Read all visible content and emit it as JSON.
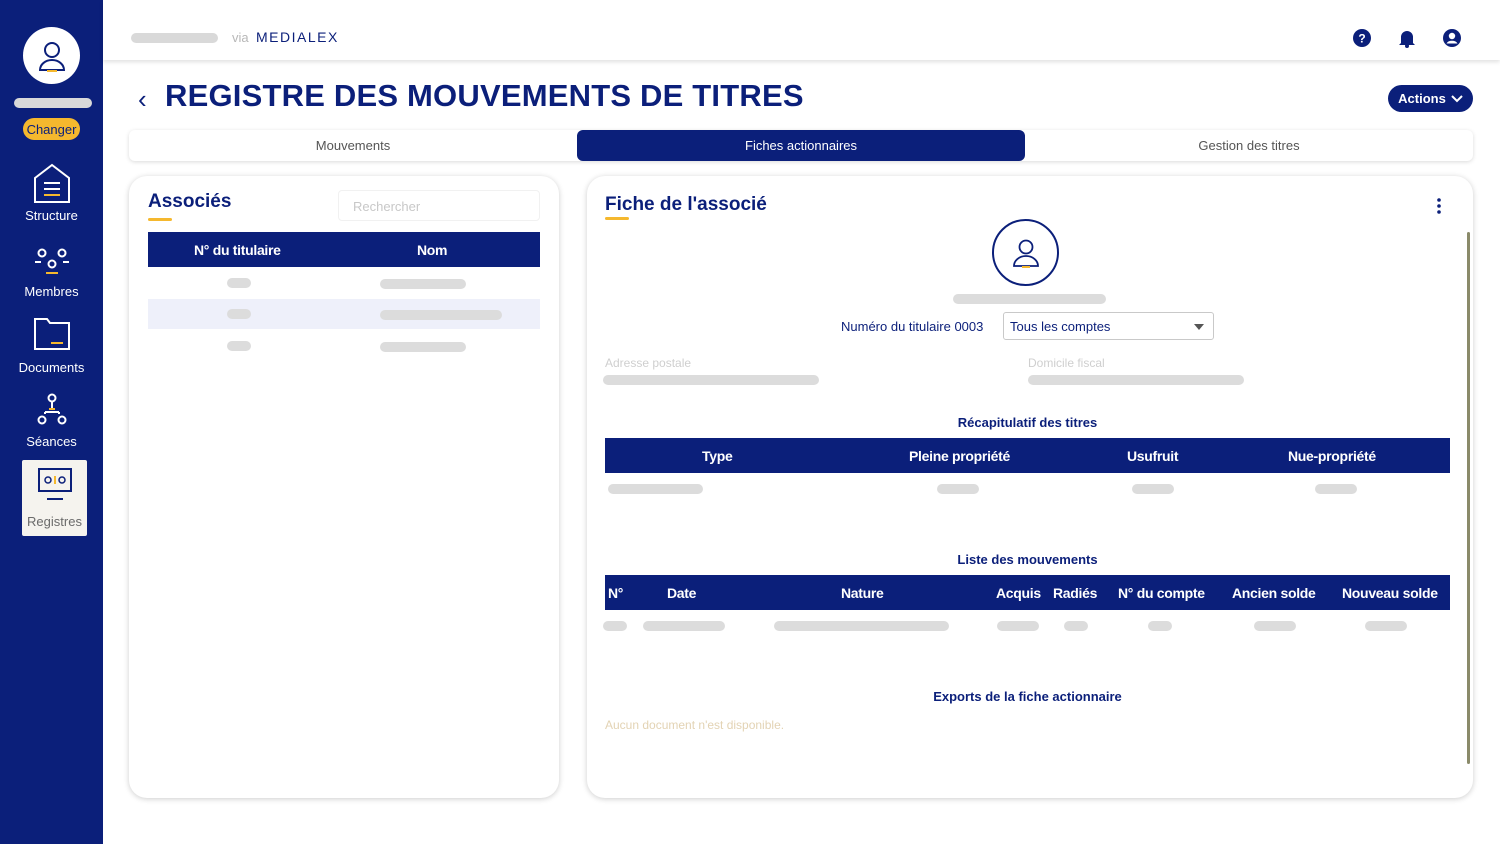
{
  "sidebar": {
    "change_label": "Changer",
    "items": [
      {
        "label": "Structure",
        "icon": "structure-icon"
      },
      {
        "label": "Membres",
        "icon": "members-icon"
      },
      {
        "label": "Documents",
        "icon": "folder-icon"
      },
      {
        "label": "Séances",
        "icon": "meetings-icon"
      },
      {
        "label": "Registres",
        "icon": "registers-icon",
        "active": true
      }
    ]
  },
  "topbar": {
    "via": "via",
    "brand": "MEDIALEX",
    "icons": [
      "help-icon",
      "bell-icon",
      "account-icon"
    ]
  },
  "page": {
    "title": "REGISTRE DES MOUVEMENTS DE TITRES",
    "actions_label": "Actions"
  },
  "tabs": [
    {
      "label": "Mouvements"
    },
    {
      "label": "Fiches actionnaires",
      "active": true
    },
    {
      "label": "Gestion des titres"
    }
  ],
  "associates": {
    "title": "Associés",
    "search_placeholder": "Rechercher",
    "columns": [
      "N° du titulaire",
      "Nom"
    ]
  },
  "sheet": {
    "title": "Fiche de l'associé",
    "holder_number_label": "Numéro du titulaire 0003",
    "account_select": "Tous les comptes",
    "postal_address_label": "Adresse postale",
    "tax_domicile_label": "Domicile fiscal",
    "summary_title": "Récapitulatif des titres",
    "summary_columns": [
      "Type",
      "Pleine propriété",
      "Usufruit",
      "Nue-propriété"
    ],
    "movements_title": "Liste des mouvements",
    "movements_columns": [
      "N°",
      "Date",
      "Nature",
      "Acquis",
      "Radiés",
      "N° du compte",
      "Ancien solde",
      "Nouveau solde"
    ],
    "exports_title": "Exports de la fiche actionnaire",
    "no_documents": "Aucun document n'est disponible."
  },
  "colors": {
    "primary": "#0b1f7a",
    "accent": "#f5b82e"
  }
}
